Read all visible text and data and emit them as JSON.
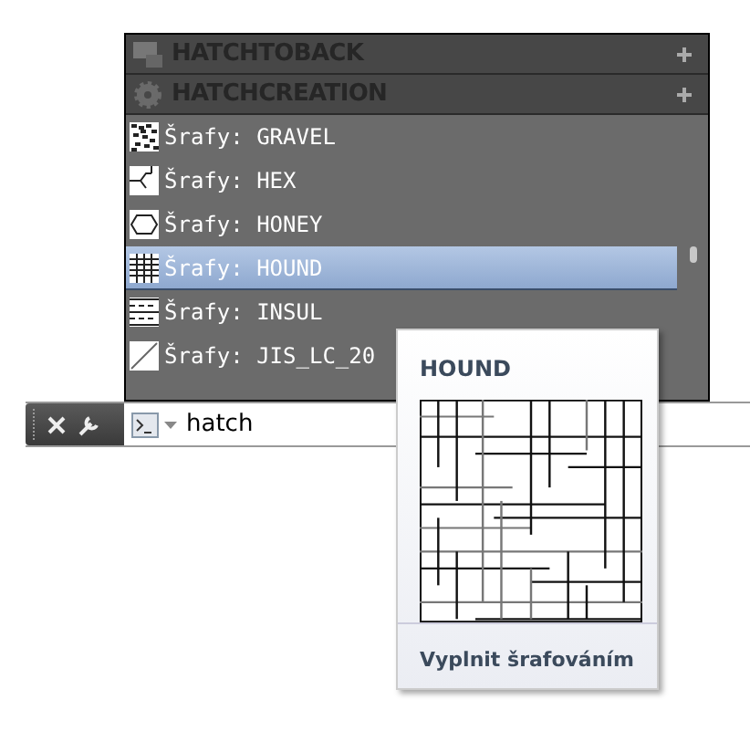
{
  "palette": {
    "groups": [
      {
        "title": "HATCHTOBACK",
        "expanded": false
      },
      {
        "title": "HATCHCREATION",
        "expanded": false
      }
    ],
    "items": [
      {
        "label": "Šrafy: GRAVEL",
        "selected": false
      },
      {
        "label": "Šrafy: HEX",
        "selected": false
      },
      {
        "label": "Šrafy: HONEY",
        "selected": false
      },
      {
        "label": "Šrafy: HOUND",
        "selected": true
      },
      {
        "label": "Šrafy: INSUL",
        "selected": false
      },
      {
        "label": "Šrafy: JIS_LC_20",
        "selected": false
      }
    ]
  },
  "command_line": {
    "value": "hatch"
  },
  "tooltip": {
    "title": "HOUND",
    "footer": "Vyplnit šrafováním"
  }
}
